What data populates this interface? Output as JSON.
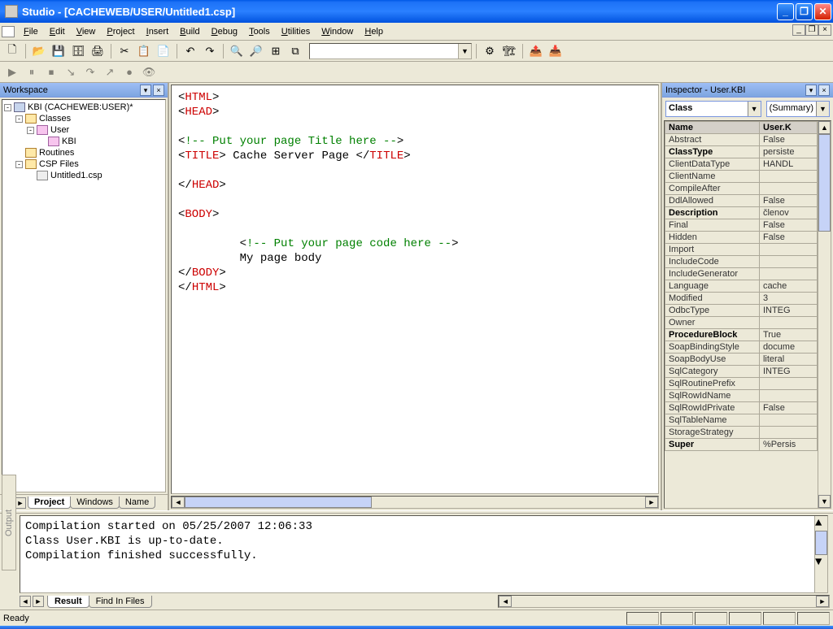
{
  "window": {
    "title": "Studio - [CACHEWEB/USER/Untitled1.csp]"
  },
  "menu": {
    "file": "File",
    "edit": "Edit",
    "view": "View",
    "project": "Project",
    "insert": "Insert",
    "build": "Build",
    "debug": "Debug",
    "tools": "Tools",
    "utilities": "Utilities",
    "window": "Window",
    "help": "Help"
  },
  "workspace": {
    "title": "Workspace",
    "root": "KBI (CACHEWEB:USER)*",
    "classes": "Classes",
    "user": "User",
    "kbi": "KBI",
    "routines": "Routines",
    "cspfiles": "CSP Files",
    "untitled": "Untitled1.csp",
    "tabs": {
      "project": "Project",
      "windows": "Windows",
      "name": "Name"
    }
  },
  "code": {
    "l1a": "HTML",
    "l2a": "HEAD",
    "l4c": "!-- Put your page Title here --",
    "l5a": "TITLE",
    "l5t": " Cache Server Page ",
    "l5b": "TITLE",
    "l7a": "HEAD",
    "l9a": "BODY",
    "l11c": "!-- Put your page code here --",
    "l12t": "My page body",
    "l13a": "BODY",
    "l14a": "HTML"
  },
  "inspector": {
    "title": "Inspector - User.KBI",
    "comboClass": "Class",
    "comboSummary": "(Summary)",
    "header": {
      "name": "Name",
      "val": "User.K"
    },
    "rows": [
      {
        "k": "Abstract",
        "v": "False"
      },
      {
        "k": "ClassType",
        "v": "persiste",
        "b": true
      },
      {
        "k": "ClientDataType",
        "v": "HANDL"
      },
      {
        "k": "ClientName",
        "v": ""
      },
      {
        "k": "CompileAfter",
        "v": ""
      },
      {
        "k": "DdlAllowed",
        "v": "False"
      },
      {
        "k": "Description",
        "v": "členov",
        "b": true
      },
      {
        "k": "Final",
        "v": "False"
      },
      {
        "k": "Hidden",
        "v": "False"
      },
      {
        "k": "Import",
        "v": ""
      },
      {
        "k": "IncludeCode",
        "v": ""
      },
      {
        "k": "IncludeGenerator",
        "v": ""
      },
      {
        "k": "Language",
        "v": "cache"
      },
      {
        "k": "Modified",
        "v": "3"
      },
      {
        "k": "OdbcType",
        "v": "INTEG"
      },
      {
        "k": "Owner",
        "v": ""
      },
      {
        "k": "ProcedureBlock",
        "v": "True",
        "b": true
      },
      {
        "k": "SoapBindingStyle",
        "v": "docume"
      },
      {
        "k": "SoapBodyUse",
        "v": "literal"
      },
      {
        "k": "SqlCategory",
        "v": "INTEG"
      },
      {
        "k": "SqlRoutinePrefix",
        "v": ""
      },
      {
        "k": "SqlRowIdName",
        "v": ""
      },
      {
        "k": "SqlRowIdPrivate",
        "v": "False"
      },
      {
        "k": "SqlTableName",
        "v": ""
      },
      {
        "k": "StorageStrategy",
        "v": ""
      },
      {
        "k": "Super",
        "v": "%Persis",
        "b": true
      }
    ]
  },
  "output": {
    "l1": "Compilation started on 05/25/2007 12:06:33",
    "l2": "Class User.KBI is up-to-date.",
    "l3": "Compilation finished successfully.",
    "tabs": {
      "result": "Result",
      "find": "Find In Files"
    },
    "sidelabel": "Output"
  },
  "status": {
    "ready": "Ready"
  }
}
